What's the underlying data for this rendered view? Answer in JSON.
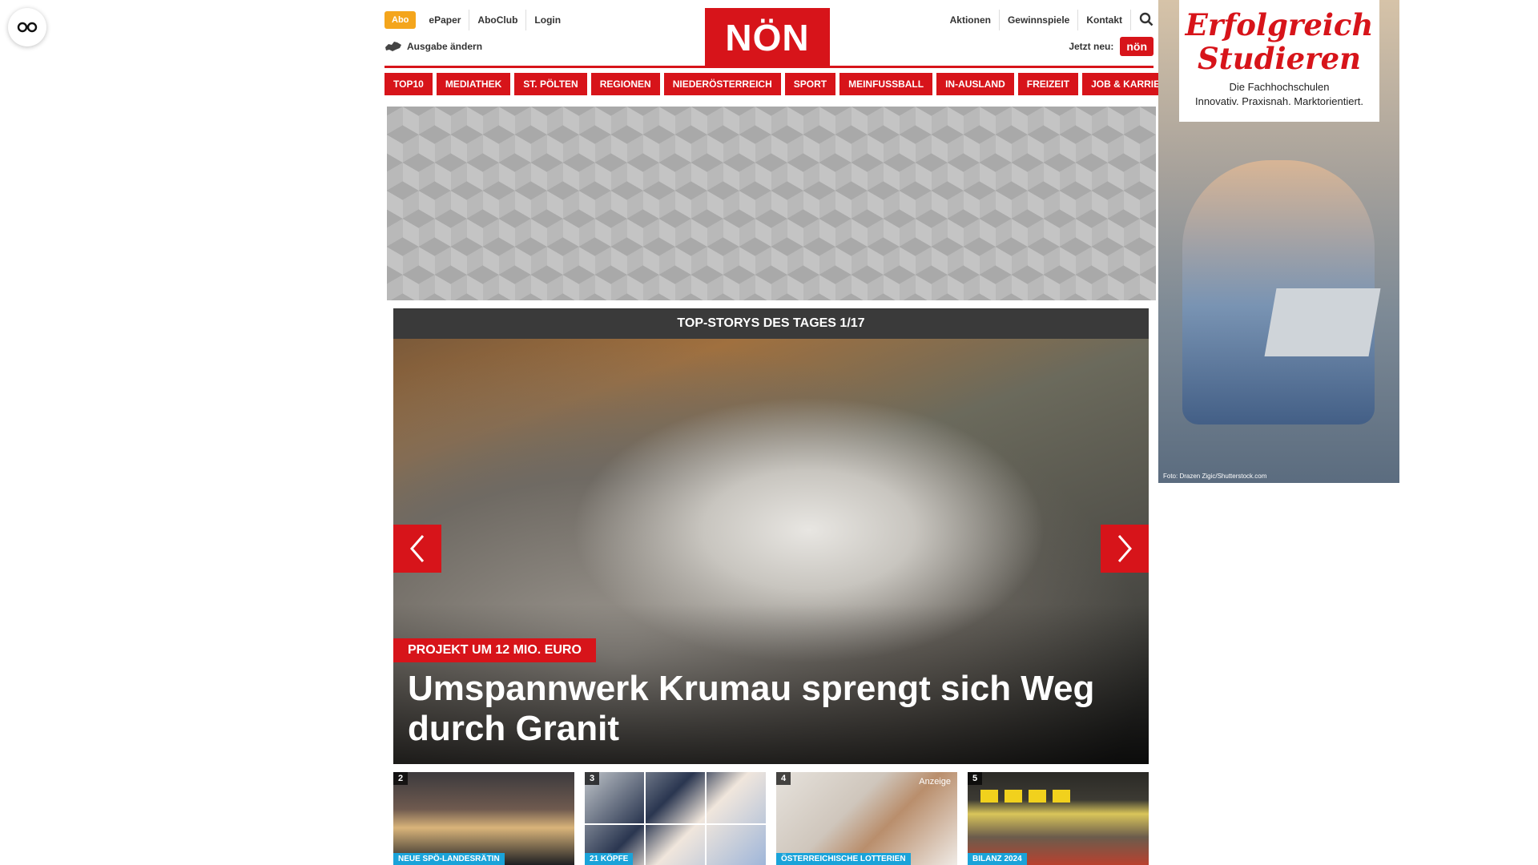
{
  "reader_button": {
    "icon": "glasses-icon"
  },
  "header": {
    "abo_label": "Abo",
    "left_links": [
      "ePaper",
      "AboClub",
      "Login"
    ],
    "edition_label": "Ausgabe ändern",
    "logo_text": "NÖN",
    "right_links": [
      "Aktionen",
      "Gewinnspiele",
      "Kontakt"
    ],
    "jetzt_label": "Jetzt neu:",
    "jetzt_badge": "nön"
  },
  "mainnav": [
    "TOP10",
    "MEDIATHEK",
    "ST. PÖLTEN",
    "REGIONEN",
    "NIEDERÖSTERREICH",
    "SPORT",
    "MEINFUSSBALL",
    "IN-AUSLAND",
    "FREIZEIT",
    "JOB & KARRIERE"
  ],
  "slider": {
    "title": "TOP-STORYS DES TAGES 1/17",
    "kicker": "PROJEKT UM 12 MIO. EURO",
    "headline": "Umspannwerk Krumau sprengt sich Weg durch Granit"
  },
  "teasers": [
    {
      "num": "2",
      "tag": "NEUE SPÖ-LANDESRÄTIN"
    },
    {
      "num": "3",
      "tag": "21 KÖPFE"
    },
    {
      "num": "4",
      "tag": "ÖSTERREICHISCHE LOTTERIEN",
      "anzeige": "Anzeige"
    },
    {
      "num": "5",
      "tag": "BILANZ 2024"
    }
  ],
  "rightad": {
    "title_line1": "Erfolgreich",
    "title_line2": "Studieren",
    "sub_line1": "Die Fachhochschulen",
    "sub_line2": "Innovativ. Praxisnah. Marktorientiert.",
    "credit": "Foto: Drazen Zigic/Shutterstock.com"
  },
  "colors": {
    "brand_red": "#d7141a",
    "abo_orange": "#f4a51c",
    "tag_blue": "#1aa3d9"
  }
}
